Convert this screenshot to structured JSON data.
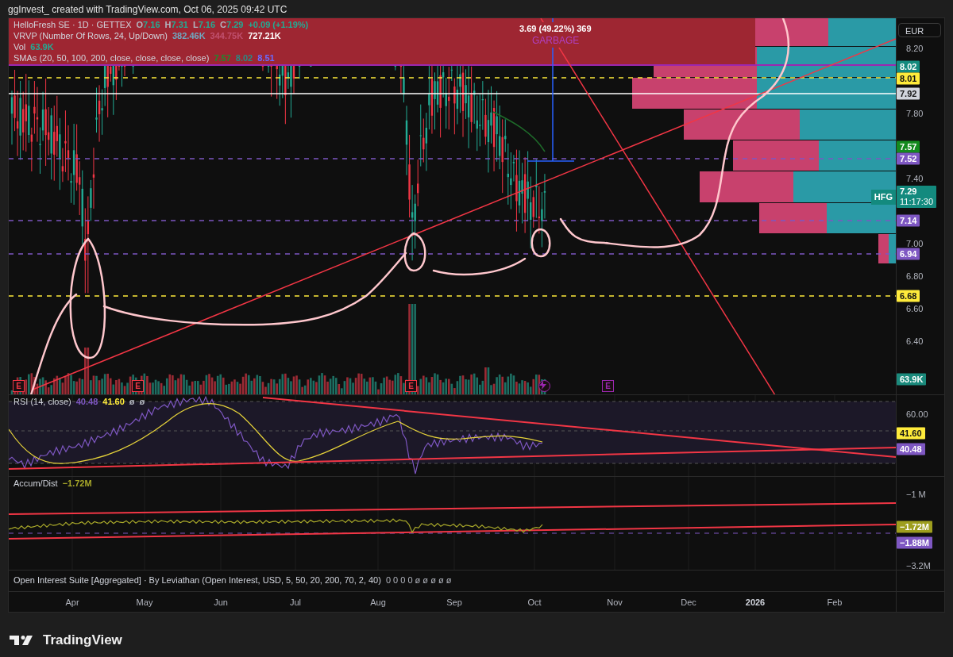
{
  "header": {
    "text": "ggInvest_ created with TradingView.com, Oct 06, 2025 09:42 UTC"
  },
  "main_pane": {
    "legend": [
      {
        "title": "HelloFresh SE · 1D · GETTEX",
        "values": [
          {
            "label": "O",
            "value": "7.16",
            "color": "#22ab94"
          },
          {
            "label": "H",
            "value": "7.31",
            "color": "#22ab94"
          },
          {
            "label": "L",
            "value": "7.16",
            "color": "#22ab94"
          },
          {
            "label": "C",
            "value": "7.29",
            "color": "#22ab94"
          },
          {
            "value": "+0.09 (+1.19%)",
            "color": "#22ab94"
          }
        ]
      },
      {
        "title": "VRVP (Number Of Rows, 24, Up/Down)",
        "values": [
          {
            "value": "382.46K",
            "color": "#6fa8c0"
          },
          {
            "value": "344.75K",
            "color": "#c0506e"
          },
          {
            "value": "727.21K",
            "color": "#ffffff"
          }
        ]
      },
      {
        "title": "Vol",
        "values": [
          {
            "value": "63.9K",
            "color": "#22ab94"
          }
        ]
      },
      {
        "title": "SMAs (20, 50, 100, 200, close, close, close, close)",
        "values": [
          {
            "value": "7.57",
            "color": "#1e8a2e"
          },
          {
            "value": "8.02",
            "color": "#2a8a84"
          },
          {
            "value": "8.51",
            "color": "#6a6aff"
          }
        ]
      }
    ],
    "measure_label": "3.69 (49.22%) 369",
    "note_label": "GARBAGE",
    "markers": [
      {
        "kind": "earnings",
        "text": "E",
        "color": "#f23645"
      },
      {
        "kind": "earnings",
        "text": "E",
        "color": "#f23645"
      },
      {
        "kind": "earnings",
        "text": "E",
        "color": "#f23645"
      },
      {
        "kind": "event",
        "color": "#9c27b0"
      },
      {
        "kind": "earnings",
        "text": "E",
        "color": "#9c27b0"
      }
    ]
  },
  "price_axis": {
    "currency": "EUR",
    "ticks": [
      "8.20",
      "7.80",
      "7.40",
      "7.00",
      "6.80",
      "6.60",
      "6.40"
    ],
    "tags": [
      {
        "text": "8.02",
        "color": "#138a7e"
      },
      {
        "text": "8.01",
        "color": "#ffeb3b"
      },
      {
        "text": "7.92",
        "color": "#d1d4dc"
      },
      {
        "text": "7.57",
        "color": "#138a1e"
      },
      {
        "text": "7.52",
        "color": "#7e57c2"
      },
      {
        "text": "7.14",
        "color": "#7e57c2"
      },
      {
        "text": "6.94",
        "color": "#7e57c2"
      },
      {
        "text": "6.68",
        "color": "#ffeb3b"
      }
    ],
    "symbol_tag": {
      "symbol": "HFG",
      "price": "7.29",
      "countdown": "11:17:30"
    },
    "volume_tag": "63.9K"
  },
  "rsi_pane": {
    "title": "RSI (14, close)",
    "values": [
      {
        "value": "40.48",
        "color": "#7e57c2"
      },
      {
        "value": "41.60",
        "color": "#ffeb3b"
      },
      {
        "value": "ø",
        "color": "#b2b5be"
      },
      {
        "value": "ø",
        "color": "#b2b5be"
      }
    ],
    "ticks": [
      "60.00"
    ],
    "tags": [
      {
        "text": "41.60",
        "color": "#ffeb3b"
      },
      {
        "text": "40.48",
        "color": "#7e57c2"
      }
    ]
  },
  "ad_pane": {
    "title": "Accum/Dist",
    "values": [
      {
        "value": "−1.72M",
        "color": "#a8a82a"
      }
    ],
    "ticks": [
      "−1 M",
      "−3.2M"
    ],
    "tags": [
      {
        "text": "−1.72M",
        "color": "#9e9e1e"
      },
      {
        "text": "−1.88M",
        "color": "#7e57c2"
      }
    ]
  },
  "oi_pane": {
    "title": "Open Interest Suite [Aggregated] · By Leviathan (Open Interest, USD, 5, 50, 20, 200, 70, 2, 40)",
    "values": "0 0 0 0 ø ø ø ø ø"
  },
  "time_axis": [
    {
      "label": "Apr",
      "kind": "month"
    },
    {
      "label": "May",
      "kind": "month"
    },
    {
      "label": "Jun",
      "kind": "month"
    },
    {
      "label": "Jul",
      "kind": "month"
    },
    {
      "label": "Aug",
      "kind": "month"
    },
    {
      "label": "Sep",
      "kind": "month"
    },
    {
      "label": "Oct",
      "kind": "month"
    },
    {
      "label": "Nov",
      "kind": "month"
    },
    {
      "label": "Dec",
      "kind": "month"
    },
    {
      "label": "2026",
      "kind": "year"
    },
    {
      "label": "Feb",
      "kind": "month"
    }
  ],
  "footer": {
    "brand": "TradingView"
  }
}
